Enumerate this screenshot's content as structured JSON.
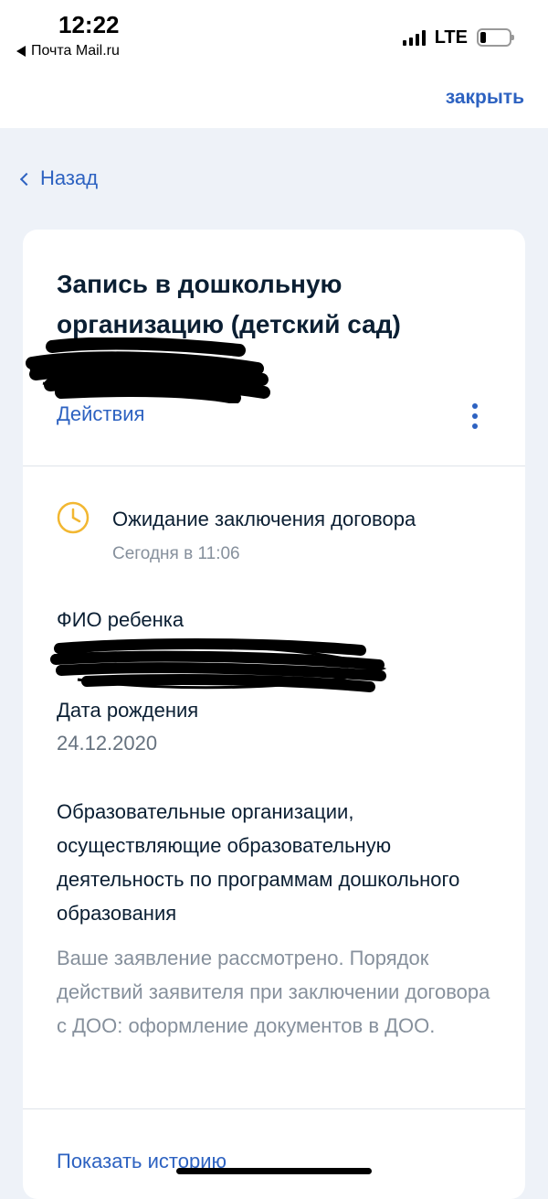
{
  "status_bar": {
    "time": "12:22",
    "back_app": "Почта Mail.ru",
    "network": "LTE",
    "battery_level": 0.2
  },
  "header": {
    "close_label": "закрыть"
  },
  "nav": {
    "back_label": "Назад"
  },
  "card": {
    "title": "Запись в дошкольную организацию (детский сад)",
    "actions_label": "Действия",
    "status": {
      "text": "Ожидание заключения договора",
      "time": "Сегодня в 11:06"
    },
    "child_name_label": "ФИО ребенка",
    "birth_date_label": "Дата рождения",
    "birth_date": "24.12.2020",
    "org_title": "Образовательные организации, осуществляющие образовательную деятельность по программам дошкольного образования",
    "org_description": "Ваше заявление рассмотрено. Порядок действий заявителя при заключении договора с ДОО: оформление документов в ДОО.",
    "history_label": "Показать историю"
  },
  "colors": {
    "accent": "#2d62c1",
    "status_icon": "#f2b731",
    "background": "#eef2f8"
  }
}
